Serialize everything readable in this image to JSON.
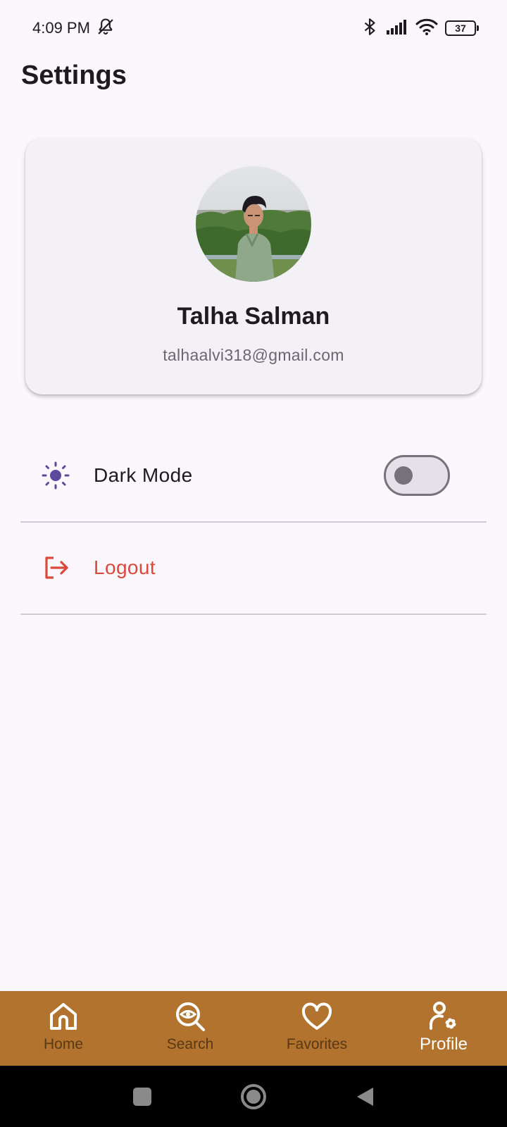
{
  "status_bar": {
    "time": "4:09 PM",
    "battery": "37",
    "icons": [
      "notifications-off-icon",
      "bluetooth-icon",
      "signal-icon",
      "wifi-icon",
      "battery-icon"
    ]
  },
  "header": {
    "title": "Settings"
  },
  "profile": {
    "name": "Talha Salman",
    "email": "talhaalvi318@gmail.com",
    "avatar": "profile-photo"
  },
  "settings": {
    "dark_mode": {
      "label": "Dark Mode",
      "icon": "sun-icon",
      "enabled": false
    },
    "logout": {
      "label": "Logout",
      "icon": "logout-icon"
    }
  },
  "bottom_nav": {
    "items": [
      {
        "label": "Home",
        "icon": "home-icon",
        "active": false
      },
      {
        "label": "Search",
        "icon": "search-eye-icon",
        "active": false
      },
      {
        "label": "Favorites",
        "icon": "heart-icon",
        "active": false
      },
      {
        "label": "Profile",
        "icon": "profile-settings-icon",
        "active": true
      }
    ]
  },
  "colors": {
    "background": "#fcf7fd",
    "card": "#f4f1f6",
    "accent": "#5b4a9e",
    "logout": "#d94a3d",
    "nav_bar": "#b1732e",
    "nav_inactive": "#5a3814",
    "nav_active": "#ffffff"
  }
}
